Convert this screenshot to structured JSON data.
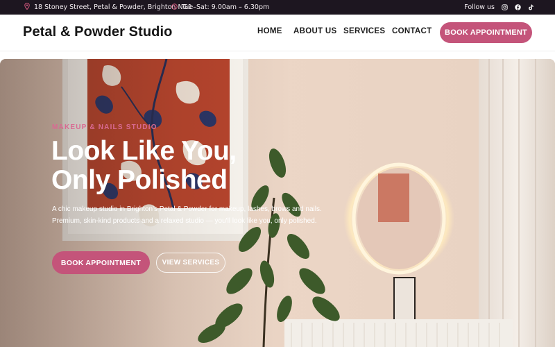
{
  "topbar": {
    "address": "18 Stoney Street, Petal & Powder, Brighton NG1",
    "hours": "Tue–Sat: 9.00am – 6.30pm",
    "follow_label": "Follow us",
    "social_icons": [
      "instagram-icon",
      "facebook-icon",
      "tiktok-icon"
    ]
  },
  "header": {
    "logo": "Petal & Powder Studio",
    "nav": [
      "HOME",
      "ABOUT US",
      "SERVICES",
      "CONTACT"
    ],
    "cta": "BOOK APPOINTMENT"
  },
  "hero": {
    "eyebrow": "MAKEUP & NAILS STUDIO",
    "headline": "Look Like You, Only Polished",
    "subtext": "A chic makeup studio in Brighton's Petal & Powder for makeup, lashes, brows and nails. Premium, skin-kind products and a relaxed studio — you'll look like you, only polished.",
    "primary_button": "BOOK APPOINTMENT",
    "secondary_button": "VIEW SERVICES"
  },
  "colors": {
    "accent": "#c4547a",
    "topbar_bg": "#1d1620",
    "eyebrow": "#d96a92"
  }
}
